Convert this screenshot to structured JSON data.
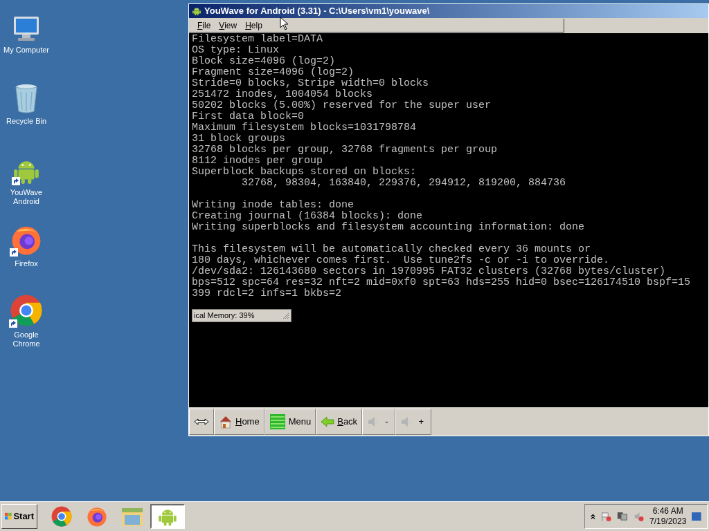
{
  "desktop_icons": [
    {
      "kind": "computer",
      "label": "My Computer",
      "shortcut": false
    },
    {
      "kind": "recycle",
      "label": "Recycle Bin",
      "shortcut": false
    },
    {
      "kind": "android",
      "label": "YouWave Android",
      "shortcut": true
    },
    {
      "kind": "firefox",
      "label": "Firefox",
      "shortcut": true
    },
    {
      "kind": "chrome",
      "label": "Google Chrome",
      "shortcut": true
    }
  ],
  "window": {
    "title": "YouWave for Android (3.31) - C:\\Users\\vm1\\youwave\\",
    "menu": [
      {
        "label": "File",
        "underline_first": true
      },
      {
        "label": "View",
        "underline_first": true
      },
      {
        "label": "Help",
        "underline_first": true
      }
    ],
    "terminal_blocks": [
      [
        "Filesystem label=DATA",
        "OS type: Linux",
        "Block size=4096 (log=2)",
        "Fragment size=4096 (log=2)",
        "Stride=0 blocks, Stripe width=0 blocks",
        "251472 inodes, 1004054 blocks",
        "50202 blocks (5.00%) reserved for the super user",
        "First data block=0",
        "Maximum filesystem blocks=1031798784",
        "31 block groups",
        "32768 blocks per group, 32768 fragments per group",
        "8112 inodes per group",
        "Superblock backups stored on blocks:",
        "        32768, 98304, 163840, 229376, 294912, 819200, 884736"
      ],
      [
        "Writing inode tables: done",
        "Creating journal (16384 blocks): done",
        "Writing superblocks and filesystem accounting information: done"
      ],
      [
        "This filesystem will be automatically checked every 36 mounts or",
        "180 days, whichever comes first.  Use tune2fs -c or -i to override.",
        "/dev/sda2: 126143680 sectors in 1970995 FAT32 clusters (32768 bytes/cluster)",
        "bps=512 spc=64 res=32 nft=2 mid=0xf0 spt=63 hds=255 hid=0 bsec=126174510 bspf=15",
        "399 rdcl=2 infs=1 bkbs=2"
      ]
    ],
    "memory_popup": "ical Memory: 39%",
    "toolbar": [
      {
        "kind": "resize"
      },
      {
        "kind": "home",
        "label": "Home",
        "underline_first": true
      },
      {
        "kind": "menu",
        "label": "Menu",
        "underline_first": false
      },
      {
        "kind": "back",
        "label": "Back",
        "underline_first": true
      },
      {
        "kind": "volume",
        "label": "-"
      },
      {
        "kind": "volume",
        "label": "+"
      }
    ]
  },
  "taskbar": {
    "start": "Start",
    "apps": [
      {
        "kind": "chrome",
        "selected": false
      },
      {
        "kind": "firefox",
        "selected": false
      },
      {
        "kind": "folder",
        "selected": false
      },
      {
        "kind": "android",
        "selected": true
      }
    ],
    "time": "6:46 AM",
    "date": "7/19/2023"
  }
}
